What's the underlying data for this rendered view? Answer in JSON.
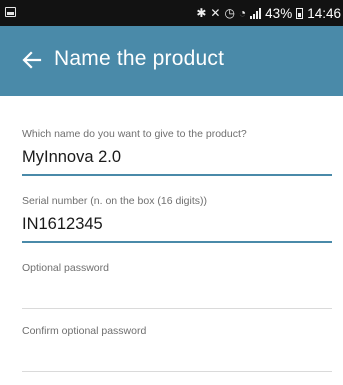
{
  "status_bar": {
    "battery_percent": "43%",
    "time": "14:46",
    "icons": [
      "notification-icon",
      "bluetooth-icon",
      "mute-icon",
      "alarm-icon",
      "wifi-icon",
      "signal-icon",
      "battery-icon"
    ]
  },
  "app_bar": {
    "title": "Name the product",
    "back_icon": "arrow-left-icon",
    "color": "#4a8aa9"
  },
  "form": {
    "product_name": {
      "label": "Which name do you want to give to the product?",
      "value": "MyInnova 2.0"
    },
    "serial_number": {
      "label": "Serial number (n. on the box (16 digits))",
      "value": "IN1612345"
    },
    "optional_password": {
      "label": "Optional password",
      "value": ""
    },
    "confirm_password": {
      "label": "Confirm optional password",
      "value": ""
    }
  }
}
